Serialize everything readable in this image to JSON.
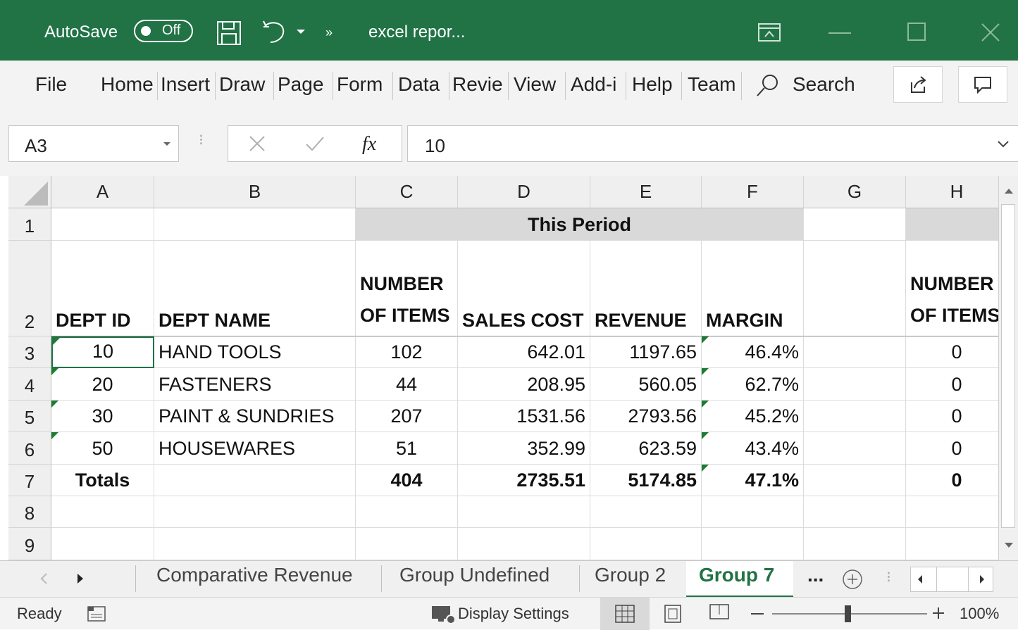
{
  "titlebar": {
    "autosave_label": "AutoSave",
    "toggle_state": "Off",
    "filename": "excel repor...",
    "color": "#217346"
  },
  "ribbon": {
    "tabs": [
      "File",
      "Home",
      "Insert",
      "Draw",
      "Page",
      "Form",
      "Data",
      "Revie",
      "View",
      "Add-i",
      "Help",
      "Team"
    ],
    "search_label": "Search"
  },
  "formula_bar": {
    "name_box": "A3",
    "fx_label": "fx",
    "value": "10"
  },
  "grid": {
    "columns": [
      "A",
      "B",
      "C",
      "D",
      "E",
      "F",
      "G",
      "H"
    ],
    "row_numbers": [
      "1",
      "2",
      "3",
      "4",
      "5",
      "6",
      "7",
      "8",
      "9"
    ],
    "merged_header": "This Period",
    "headers": {
      "dept_id": "DEPT ID",
      "dept_name": "DEPT NAME",
      "items_1": "NUMBER",
      "items_2": "OF ITEMS",
      "sales_cost": "SALES COST",
      "revenue": "REVENUE",
      "margin": "MARGIN",
      "h_items_1": "NUMBER",
      "h_items_2": "OF ITEMS"
    },
    "rows": [
      {
        "id": "10",
        "name": "HAND TOOLS",
        "items": "102",
        "cost": "642.01",
        "revenue": "1197.65",
        "margin": "46.4%",
        "h": "0"
      },
      {
        "id": "20",
        "name": "FASTENERS",
        "items": "44",
        "cost": "208.95",
        "revenue": "560.05",
        "margin": "62.7%",
        "h": "0"
      },
      {
        "id": "30",
        "name": "PAINT & SUNDRIES",
        "items": "207",
        "cost": "1531.56",
        "revenue": "2793.56",
        "margin": "45.2%",
        "h": "0"
      },
      {
        "id": "50",
        "name": "HOUSEWARES",
        "items": "51",
        "cost": "352.99",
        "revenue": "623.59",
        "margin": "43.4%",
        "h": "0"
      }
    ],
    "totals": {
      "label": "Totals",
      "items": "404",
      "cost": "2735.51",
      "revenue": "5174.85",
      "margin": "47.1%",
      "h": "0"
    }
  },
  "sheet_tabs": {
    "tabs": [
      "Comparative Revenue",
      "Group Undefined",
      "Group 2",
      "Group 7"
    ],
    "active": "Group 7",
    "more": "...",
    "active_color": "#217346"
  },
  "status_bar": {
    "ready": "Ready",
    "display_settings": "Display Settings",
    "zoom": "100%"
  }
}
